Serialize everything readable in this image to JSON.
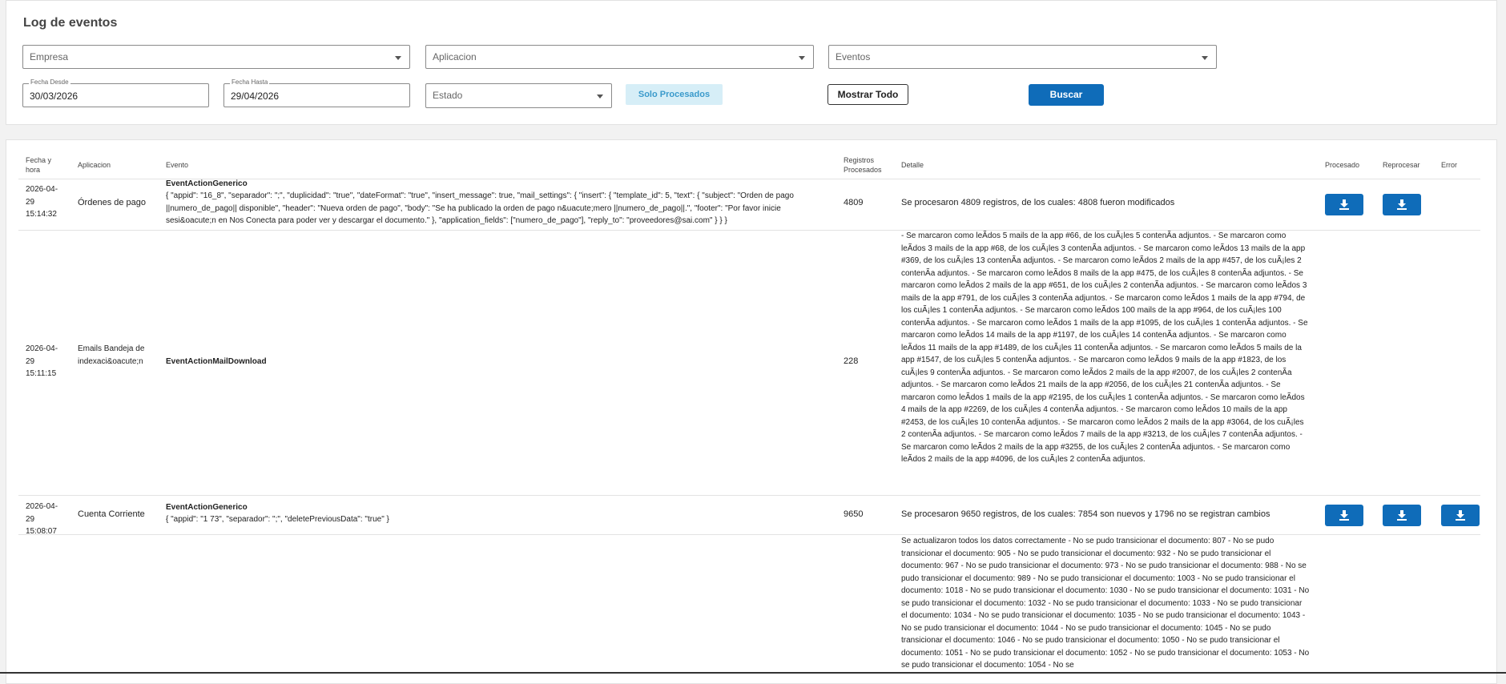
{
  "page": {
    "title": "Log de eventos"
  },
  "filters": {
    "empresa": "Empresa",
    "aplicacion": "Aplicacion",
    "eventos": "Eventos",
    "fecha_desde_label": "Fecha Desde",
    "fecha_desde": "30/03/2026",
    "fecha_hasta_label": "Fecha Hasta",
    "fecha_hasta": "29/04/2026",
    "estado": "Estado",
    "solo_procesados": "Solo Procesados",
    "mostrar_todo": "Mostrar Todo",
    "buscar": "Buscar"
  },
  "table": {
    "headers": {
      "fecha": "Fecha y hora",
      "aplicacion": "Aplicacion",
      "evento": "Evento",
      "registros": "Registros Procesados",
      "detalle": "Detalle",
      "procesado": "Procesado",
      "reprocesar": "Reprocesar",
      "error": "Error"
    },
    "rows": [
      {
        "fecha": "2026-04-29 15:14:32",
        "aplicacion": "Órdenes de pago",
        "evento_nombre": "EventActionGenerico",
        "evento_params": "{ \"appid\": \"16_8\", \"separador\": \";\", \"duplicidad\": \"true\", \"dateFormat\": \"true\", \"insert_message\": true, \"mail_settings\": { \"insert\": { \"template_id\": 5, \"text\": { \"subject\": \"Orden de pago ||numero_de_pago|| disponible\", \"header\": \"Nueva orden de pago\", \"body\": \"Se ha publicado la orden de pago n&uacute;mero ||numero_de_pago||.\", \"footer\": \"Por favor inicie sesi&oacute;n en Nos Conecta para poder ver y descargar el documento.\" }, \"application_fields\": [\"numero_de_pago\"], \"reply_to\": \"proveedores@sai.com\" } } }",
        "registros": "4809",
        "detalle": "Se procesaron 4809 registros, de los cuales: 4808 fueron modificados"
      },
      {
        "fecha": "2026-04-29 15:11:15",
        "aplicacion": "Emails Bandeja de indexaci&oacute;n",
        "evento_nombre": "EventActionMailDownload",
        "evento_params": "",
        "registros": "228",
        "detalle": "- Se marcaron como leÃdos 5 mails de la app #66, de los cuÃ¡les 5 contenÃa adjuntos. - Se marcaron como leÃdos 3 mails de la app #68, de los cuÃ¡les 3 contenÃa adjuntos. - Se marcaron como leÃdos 13 mails de la app #369, de los cuÃ¡les 13 contenÃa adjuntos. - Se marcaron como leÃdos 2 mails de la app #457, de los cuÃ¡les 2 contenÃa adjuntos. - Se marcaron como leÃdos 8 mails de la app #475, de los cuÃ¡les 8 contenÃa adjuntos. - Se marcaron como leÃdos 2 mails de la app #651, de los cuÃ¡les 2 contenÃa adjuntos. - Se marcaron como leÃdos 3 mails de la app #791, de los cuÃ¡les 3 contenÃa adjuntos. - Se marcaron como leÃdos 1 mails de la app #794, de los cuÃ¡les 1 contenÃa adjuntos. - Se marcaron como leÃdos 100 mails de la app #964, de los cuÃ¡les 100 contenÃa adjuntos. - Se marcaron como leÃdos 1 mails de la app #1095, de los cuÃ¡les 1 contenÃa adjuntos. - Se marcaron como leÃdos 14 mails de la app #1197, de los cuÃ¡les 14 contenÃa adjuntos. - Se marcaron como leÃdos 11 mails de la app #1489, de los cuÃ¡les 11 contenÃa adjuntos. - Se marcaron como leÃdos 5 mails de la app #1547, de los cuÃ¡les 5 contenÃa adjuntos. - Se marcaron como leÃdos 9 mails de la app #1823, de los cuÃ¡les 9 contenÃa adjuntos. - Se marcaron como leÃdos 2 mails de la app #2007, de los cuÃ¡les 2 contenÃa adjuntos. - Se marcaron como leÃdos 21 mails de la app #2056, de los cuÃ¡les 21 contenÃa adjuntos. - Se marcaron como leÃdos 1 mails de la app #2195, de los cuÃ¡les 1 contenÃa adjuntos. - Se marcaron como leÃdos 4 mails de la app #2269, de los cuÃ¡les 4 contenÃa adjuntos. - Se marcaron como leÃdos 10 mails de la app #2453, de los cuÃ¡les 10 contenÃa adjuntos. - Se marcaron como leÃdos 2 mails de la app #3064, de los cuÃ¡les 2 contenÃa adjuntos. - Se marcaron como leÃdos 7 mails de la app #3213, de los cuÃ¡les 7 contenÃa adjuntos. - Se marcaron como leÃdos 2 mails de la app #3255, de los cuÃ¡les 2 contenÃa adjuntos. - Se marcaron como leÃdos 2 mails de la app #4096, de los cuÃ¡les 2 contenÃa adjuntos."
      },
      {
        "fecha": "2026-04-29 15:08:07",
        "aplicacion": "Cuenta Corriente",
        "evento_nombre": "EventActionGenerico",
        "evento_params": "{ \"appid\": \"1  73\", \"separador\": \";\", \"deletePreviousData\": \"true\" }",
        "registros": "9650",
        "detalle": "Se procesaron 9650 registros, de los cuales: 7854 son nuevos y 1796 no se registran cambios"
      },
      {
        "fecha": "",
        "aplicacion": "",
        "evento_nombre": "",
        "evento_params": "",
        "registros": "",
        "detalle": "Se actualizaron todos los datos correctamente - No se pudo transicionar el documento: 807 - No se pudo transicionar el documento: 905 - No se pudo transicionar el documento: 932 - No se pudo transicionar el documento: 967 - No se pudo transicionar el documento: 973 - No se pudo transicionar el documento: 988 - No se pudo transicionar el documento: 989 - No se pudo transicionar el documento: 1003 - No se pudo transicionar el documento: 1018 - No se pudo transicionar el documento: 1030 - No se pudo transicionar el documento: 1031 - No se pudo transicionar el documento: 1032 - No se pudo transicionar el documento: 1033 - No se pudo transicionar el documento: 1034 - No se pudo transicionar el documento: 1035 - No se pudo transicionar el documento: 1043 - No se pudo transicionar el documento: 1044 - No se pudo transicionar el documento: 1045 - No se pudo transicionar el documento: 1046 - No se pudo transicionar el documento: 1050 - No se pudo transicionar el documento: 1051 - No se pudo transicionar el documento: 1052 - No se pudo transicionar el documento: 1053 - No se pudo transicionar el documento: 1054 - No se"
      }
    ]
  },
  "icons": {
    "download": "download-icon",
    "caret": "chevron-down-icon"
  },
  "colors": {
    "primary": "#0f6cb9",
    "chip_bg": "#d6eef7",
    "chip_text": "#3a9acb"
  }
}
